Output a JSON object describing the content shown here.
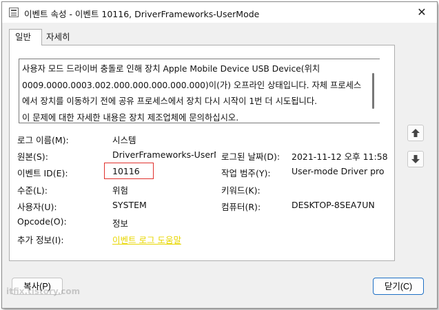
{
  "window": {
    "title": "이벤트 속성 - 이벤트 10116, DriverFrameworks-UserMode",
    "close_glyph": "✕"
  },
  "tabs": [
    {
      "label": "일반",
      "active": true
    },
    {
      "label": "자세히",
      "active": false
    }
  ],
  "description": {
    "lines": [
      "사용자 모드 드라이버 충돌로 인해 장치 Apple Mobile Device USB Device(위치",
      "0009.0000.0003.002.000.000.000.000.000)이(가) 오프라인 상태입니다. 자체 프로세스",
      "에서 장치를 이동하기 전에 공유 프로세스에서 장치 다시 시작이 1번 더 시도됩니다.",
      "이 문제에 대한 자세한 내용은 장치 제조업체에 문의하십시오."
    ]
  },
  "fields": {
    "log_name": {
      "label": "로그 이름(M):",
      "value": "시스템"
    },
    "source": {
      "label": "원본(S):",
      "value": "DriverFrameworks-UserMode"
    },
    "logged": {
      "label": "로그된 날짜(D):",
      "value": "2021-11-12 오후 11:58"
    },
    "event_id": {
      "label": "이벤트 ID(E):",
      "value": "10116"
    },
    "task_category": {
      "label": "작업 범주(Y):",
      "value": "User-mode Driver problems"
    },
    "level": {
      "label": "수준(L):",
      "value": "위험"
    },
    "keywords": {
      "label": "키워드(K):",
      "value": ""
    },
    "user": {
      "label": "사용자(U):",
      "value": "SYSTEM"
    },
    "computer": {
      "label": "컴퓨터(R):",
      "value": "DESKTOP-8SEA7UN"
    },
    "opcode": {
      "label": "Opcode(O):",
      "value": "정보"
    },
    "more_info": {
      "label": "추가 정보(I):",
      "value": "이벤트 로그 도움말"
    }
  },
  "buttons": {
    "copy": "복사(P)",
    "close": "닫기(C)"
  },
  "icons": {
    "up": "arrow-up-icon",
    "down": "arrow-down-icon"
  },
  "highlight_color": "#e0302c",
  "link_color": "#e8d700",
  "watermark": "itfix.tistory.com"
}
